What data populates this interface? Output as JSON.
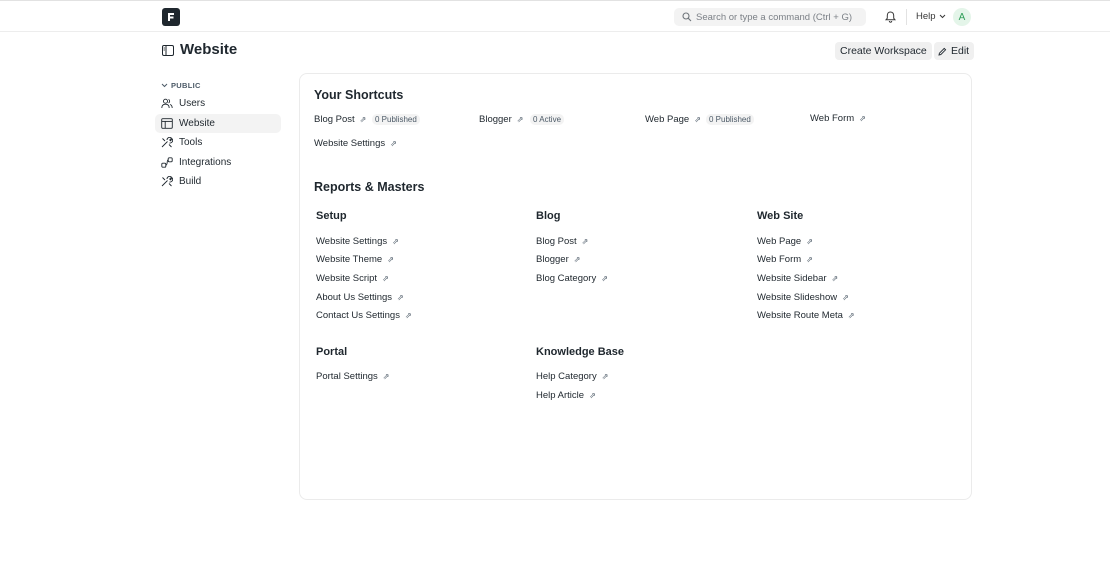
{
  "navbar": {
    "search_placeholder": "Search or type a command (Ctrl + G)",
    "help_label": "Help",
    "avatar_initial": "A"
  },
  "page": {
    "title": "Website",
    "create_workspace_label": "Create Workspace",
    "edit_label": "Edit"
  },
  "sidebar": {
    "section_label": "PUBLIC",
    "items": [
      {
        "label": "Users",
        "icon": "users-icon"
      },
      {
        "label": "Website",
        "icon": "web-icon"
      },
      {
        "label": "Tools",
        "icon": "tools-icon"
      },
      {
        "label": "Integrations",
        "icon": "integrations-icon"
      },
      {
        "label": "Build",
        "icon": "build-icon"
      }
    ]
  },
  "shortcuts": {
    "title": "Your Shortcuts",
    "items": [
      {
        "label": "Blog Post",
        "badge": "0 Published"
      },
      {
        "label": "Blogger",
        "badge": "0 Active"
      },
      {
        "label": "Web Page",
        "badge": "0 Published"
      },
      {
        "label": "Web Form",
        "badge": ""
      },
      {
        "label": "Website Settings",
        "badge": ""
      }
    ]
  },
  "reports": {
    "title": "Reports & Masters",
    "groups": [
      {
        "title": "Setup",
        "links": [
          "Website Settings",
          "Website Theme",
          "Website Script",
          "About Us Settings",
          "Contact Us Settings"
        ]
      },
      {
        "title": "Blog",
        "links": [
          "Blog Post",
          "Blogger",
          "Blog Category"
        ]
      },
      {
        "title": "Web Site",
        "links": [
          "Web Page",
          "Web Form",
          "Website Sidebar",
          "Website Slideshow",
          "Website Route Meta"
        ]
      },
      {
        "title": "Portal",
        "links": [
          "Portal Settings"
        ]
      },
      {
        "title": "Knowledge Base",
        "links": [
          "Help Category",
          "Help Article"
        ]
      }
    ]
  },
  "arrow_glyph": "⇗"
}
